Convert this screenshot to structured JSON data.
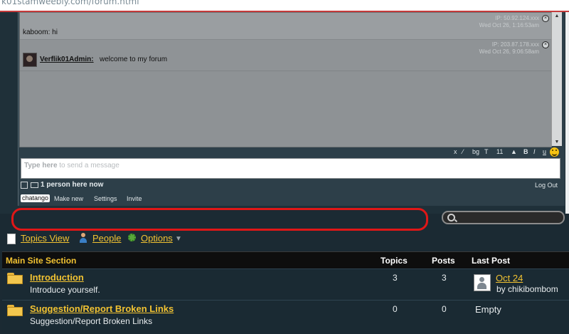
{
  "browser": {
    "url": "k01stamweebly.com/forum.html"
  },
  "chat": {
    "messages": [
      {
        "text": "kaboom: hi",
        "ip": "IP: 50.92.124.xxx",
        "time": "Wed Oct 26, 1:16:53am"
      },
      {
        "name": "Verflik01Admin:",
        "text": "welcome to my forum",
        "ip": "IP: 203.87.178.xxx",
        "time": "Wed Oct 26, 9:06:58am"
      }
    ],
    "toolbar": [
      "x",
      "⁄",
      "bg",
      "T",
      "11",
      "▲",
      "B",
      "I",
      "u"
    ],
    "input_placeholder_bold": "Type here",
    "input_placeholder_rest": " to send a message",
    "status": "1 person here now",
    "logout": "Log Out",
    "brand": "chatango",
    "links": [
      "Make new",
      "Settings",
      "Invite"
    ]
  },
  "nav": {
    "topics_view": "Topics View",
    "people": "People",
    "options": "Options"
  },
  "table": {
    "section": "Main Site Section",
    "headers": {
      "topics": "Topics",
      "posts": "Posts",
      "last_post": "Last Post"
    },
    "rows": [
      {
        "title": "Introduction",
        "desc": "Introduce yourself.",
        "topics": "3",
        "posts": "3",
        "last_post": "Oct 24",
        "by": "by chikibombom"
      },
      {
        "title": "Suggestion/Report Broken Links",
        "desc": "Suggestion/Report Broken Links",
        "topics": "0",
        "posts": "0",
        "last_post": "Empty"
      }
    ]
  },
  "colors": {
    "accent_yellow": "#f1c232",
    "highlight_red": "#e01717",
    "page_bg": "#1b2a33"
  }
}
